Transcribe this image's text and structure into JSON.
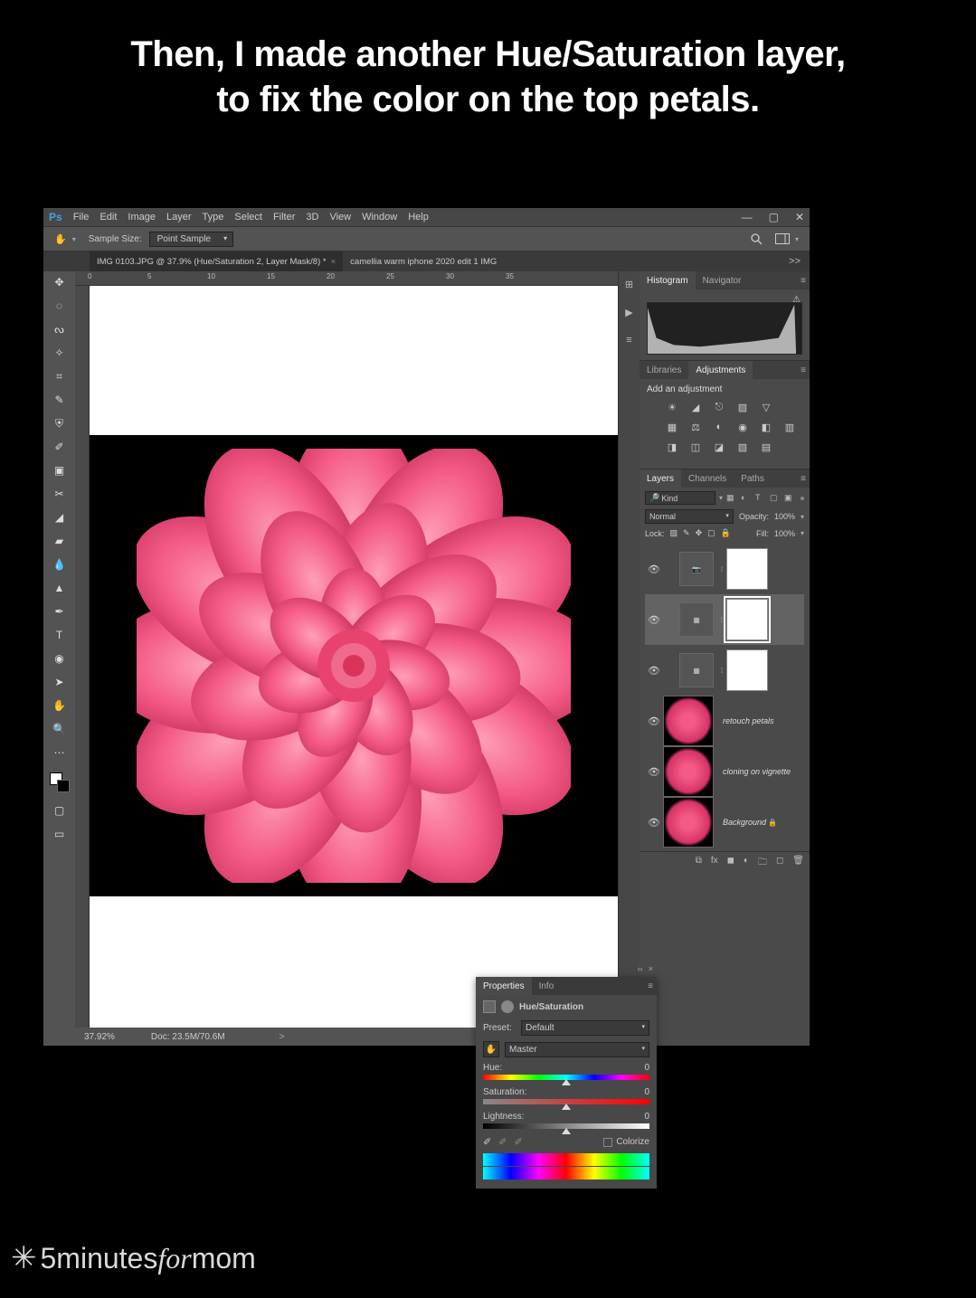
{
  "caption": {
    "line1": "Then, I made another Hue/Saturation layer,",
    "line2": "to fix the color on the top petals."
  },
  "menubar": {
    "ps": "Ps",
    "items": [
      "File",
      "Edit",
      "Image",
      "Layer",
      "Type",
      "Select",
      "Filter",
      "3D",
      "View",
      "Window",
      "Help"
    ]
  },
  "window_controls": {
    "minimize": "—",
    "maximize": "▢",
    "close": "✕"
  },
  "options_bar": {
    "sample_size_label": "Sample Size:",
    "sample_size_value": "Point Sample"
  },
  "tabs": {
    "active": "IMG 0103.JPG @ 37.9% (Hue/Saturation 2, Layer Mask/8) *",
    "inactive": "camellia warm iphone 2020 edit 1 IMG",
    "overflow": ">>"
  },
  "ruler_h": {
    "t0": "0",
    "t5": "5",
    "t10": "10",
    "t15": "15",
    "t20": "20",
    "t25": "25",
    "t30": "30",
    "t35": "35"
  },
  "status": {
    "zoom": "37.92%",
    "doc": "Doc: 23.5M/70.6M",
    "arrow": ">"
  },
  "panel_histogram": {
    "tab1": "Histogram",
    "tab2": "Navigator"
  },
  "panel_adjust": {
    "tab1": "Libraries",
    "tab2": "Adjustments",
    "label": "Add an adjustment"
  },
  "panel_layers": {
    "tab1": "Layers",
    "tab2": "Channels",
    "tab3": "Paths",
    "kind": "Kind",
    "blend": "Normal",
    "opacity_label": "Opacity:",
    "opacity_val": "100%",
    "lock_label": "Lock:",
    "fill_label": "Fill:",
    "fill_val": "100%",
    "layer_retouch": "retouch petals",
    "layer_cloning": "cloning on vignette",
    "layer_bg": "Background"
  },
  "properties": {
    "tab1": "Properties",
    "tab2": "Info",
    "title": "Hue/Saturation",
    "preset_label": "Preset:",
    "preset_val": "Default",
    "channel_val": "Master",
    "hue_label": "Hue:",
    "hue_val": "0",
    "sat_label": "Saturation:",
    "sat_val": "0",
    "light_label": "Lightness:",
    "light_val": "0",
    "colorize": "Colorize"
  },
  "watermark": {
    "brand_a": "5",
    "brand_b": "minutes",
    "brand_c": "for",
    "brand_d": "mom"
  }
}
